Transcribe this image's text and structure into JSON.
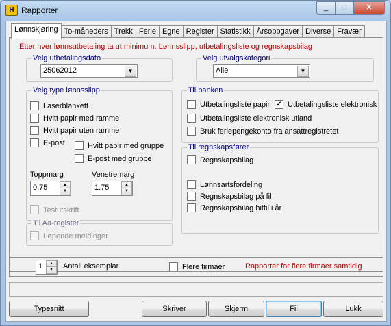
{
  "window": {
    "title": "Rapporter",
    "icon_letter": "H",
    "minimize": "_",
    "maximize": "□",
    "close": "✕"
  },
  "tabs": [
    "Lønnskjøring",
    "To-måneders",
    "Trekk",
    "Ferie",
    "Egne",
    "Register",
    "Statistikk",
    "Årsoppgaver",
    "Diverse",
    "Fravær"
  ],
  "notice": "Etter hver lønnsutbetaling ta ut minimum:  Lønnsslipp, utbetalingsliste og regnskapsbilag",
  "utbetalingsdato": {
    "legend": "Velg utbetalingsdato",
    "value": "25062012"
  },
  "utvalgskategori": {
    "legend": "Velg utvalgskategori",
    "value": "Alle"
  },
  "lonnsslipp": {
    "legend": "Velg type lønnsslipp",
    "options": {
      "laserblankett": {
        "label": "Laserblankett",
        "checked": false
      },
      "hvitt_med_ramme": {
        "label": "Hvitt papir med ramme",
        "checked": false
      },
      "hvitt_uten_ramme": {
        "label": "Hvitt papir uten ramme",
        "checked": false
      },
      "epost": {
        "label": "E-post",
        "checked": false
      },
      "hvitt_med_gruppe": {
        "label": "Hvitt papir med gruppe",
        "checked": false
      },
      "epost_med_gruppe": {
        "label": "E-post med gruppe",
        "checked": false
      }
    },
    "toppmarg_label": "Toppmarg",
    "toppmarg_value": "0.75",
    "venstremarg_label": "Venstremarg",
    "venstremarg_value": "1.75",
    "testutskrift": "Testutskrift"
  },
  "aa_register": {
    "legend": "Til Aa-register",
    "lopende": "Løpende meldinger"
  },
  "banken": {
    "legend": "Til banken",
    "papir": {
      "label": "Utbetalingsliste papir",
      "checked": false
    },
    "elektronisk": {
      "label": "Utbetalingsliste elektronisk",
      "checked": true
    },
    "utland": {
      "label": "Utbetalingsliste elektronisk utland",
      "checked": false
    },
    "feriepenge": {
      "label": "Bruk feriepengekonto fra ansattregistretet",
      "checked": false
    }
  },
  "regnskap": {
    "legend": "Til regnskapsfører",
    "regnskapsbilag": "Regnskapsbilag",
    "lonnsartsfordeling": "Lønnsartsfordeling",
    "bilag_fil": "Regnskapsbilag på fil",
    "bilag_hittil": "Regnskapsbilag hittil i år"
  },
  "bottom": {
    "antall_value": "1",
    "antall_label": "Antall eksemplar",
    "flere_firmaer": "Flere firmaer",
    "flere_note": "Rapporter for flere firmaer samtidig"
  },
  "status_text": "",
  "buttons": {
    "typesnitt": "Typesnitt",
    "skriver": "Skriver",
    "skjerm": "Skjerm",
    "fil": "Fil",
    "lukk": "Lukk"
  },
  "colors": {
    "notice": "#c00000",
    "legend": "#000080",
    "titlebar": "#b9d1ea"
  }
}
